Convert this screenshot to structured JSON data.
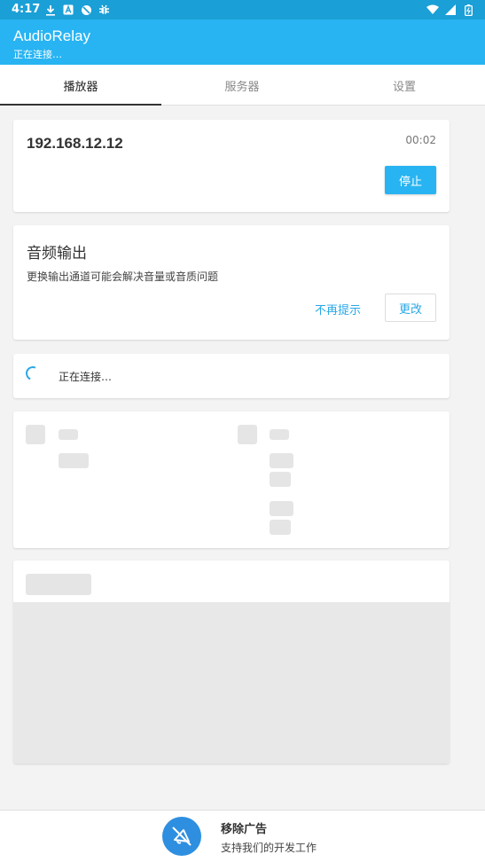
{
  "status_bar": {
    "time": "4:17",
    "left_icons": [
      "download-icon",
      "a-box-icon",
      "do-not-disturb-icon",
      "bug-icon"
    ],
    "right_icons": [
      "wifi-icon",
      "signal-icon",
      "battery-icon"
    ]
  },
  "app_bar": {
    "title": "AudioRelay",
    "subtitle": "正在连接…",
    "color": "#28b4f2"
  },
  "tabs": [
    {
      "label": "播放器",
      "active": true
    },
    {
      "label": "服务器",
      "active": false
    },
    {
      "label": "设置",
      "active": false
    }
  ],
  "server_card": {
    "ip": "192.168.12.12",
    "elapsed": "00:02",
    "stop_label": "停止"
  },
  "audio_card": {
    "title": "音频输出",
    "description": "更换输出通道可能会解决音量或音质问题",
    "dismiss_label": "不再提示",
    "change_label": "更改"
  },
  "connect_card": {
    "text": "正在连接…"
  },
  "bottom_bar": {
    "title": "移除广告",
    "subtitle": "支持我们的开发工作"
  }
}
